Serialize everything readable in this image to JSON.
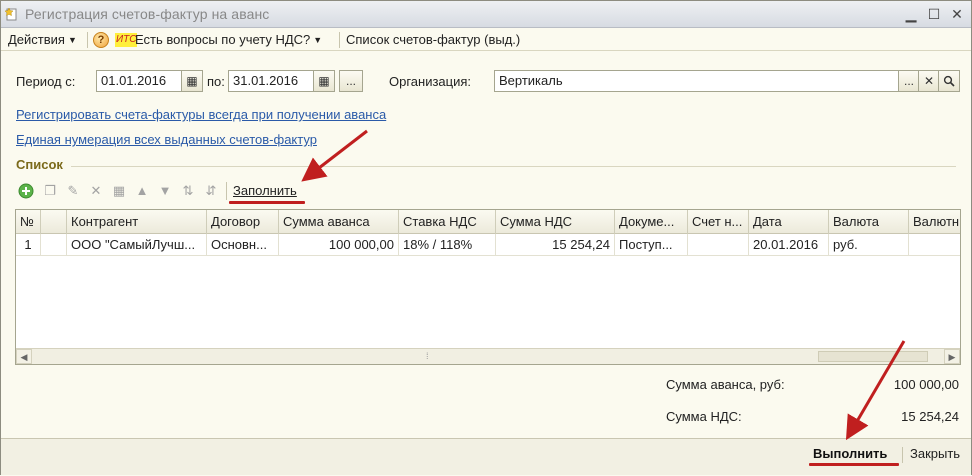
{
  "window": {
    "title": "Регистрация счетов-фактур на аванс",
    "controls": {
      "minimize": "▁",
      "maximize": "☐",
      "close": "✕"
    }
  },
  "menubar": {
    "actions": "Действия",
    "help_icon": "?",
    "its_badge": "ИТС",
    "vat_questions": "Есть вопросы по учету НДС?",
    "invoice_list": "Список счетов-фактур (выд.)"
  },
  "form": {
    "period_label": "Период с:",
    "period_from": "01.01.2016",
    "to_label": "по:",
    "period_to": "31.01.2016",
    "ellipsis": "...",
    "org_label": "Организация:",
    "org_value": "Вертикаль",
    "clear": "✕",
    "search": "🔍"
  },
  "links": {
    "always_register": "Регистрировать счета-фактуры всегда при получении аванса",
    "unified_numbering": "Единая нумерация всех выданных счетов-фактур"
  },
  "list": {
    "title": "Список",
    "fill_button": "Заполнить",
    "columns": [
      "№",
      "",
      "Контрагент",
      "Договор",
      "Сумма аванса",
      "Ставка НДС",
      "Сумма НДС",
      "Докуме...",
      "Счет н...",
      "Дата",
      "Валюта",
      "Валютн"
    ],
    "rows": [
      [
        "1",
        "",
        "ООО \"СамыйЛучш...",
        "Основн...",
        "100 000,00",
        "18% / 118%",
        "15 254,24",
        "Поступ...",
        "",
        "20.01.2016",
        "руб.",
        ""
      ]
    ]
  },
  "totals": {
    "advance_label": "Сумма аванса, руб:",
    "advance_value": "100 000,00",
    "vat_label": "Сумма НДС:",
    "vat_value": "15 254,24"
  },
  "footer": {
    "execute": "Выполнить",
    "close": "Закрыть"
  },
  "colors": {
    "link": "#2a5aa8",
    "section_title": "#7b6a1b",
    "annotation_red": "#c01f1f",
    "background": "#fbfaef"
  }
}
